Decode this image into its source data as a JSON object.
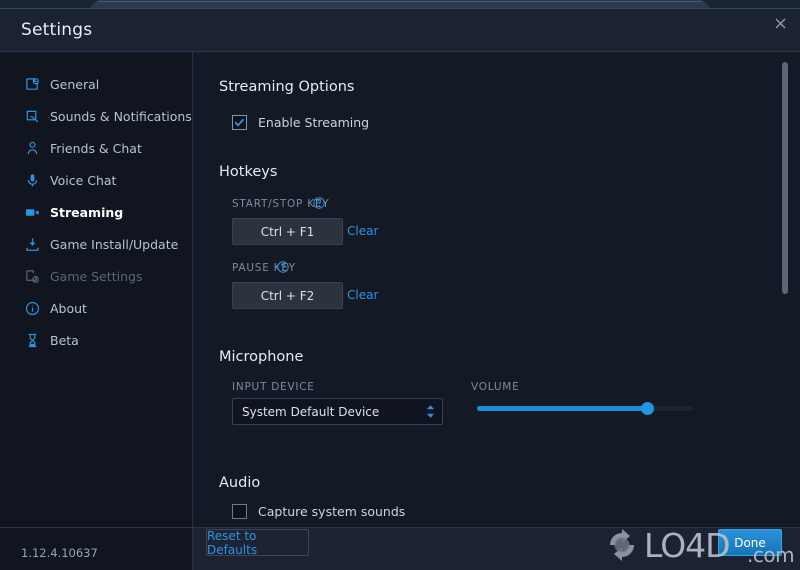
{
  "window": {
    "title": "Settings",
    "close_icon": "close-icon",
    "version": "1.12.4.10637"
  },
  "sidebar": {
    "items": [
      {
        "label": "General",
        "icon": "general-gear-icon",
        "state": "enabled"
      },
      {
        "label": "Sounds & Notifications",
        "icon": "sounds-notifications-icon",
        "state": "enabled"
      },
      {
        "label": "Friends & Chat",
        "icon": "friends-chat-icon",
        "state": "enabled"
      },
      {
        "label": "Voice Chat",
        "icon": "microphone-icon",
        "state": "enabled"
      },
      {
        "label": "Streaming",
        "icon": "video-camera-icon",
        "state": "active"
      },
      {
        "label": "Game Install/Update",
        "icon": "download-icon",
        "state": "enabled"
      },
      {
        "label": "Game Settings",
        "icon": "game-settings-icon",
        "state": "disabled"
      },
      {
        "label": "About",
        "icon": "info-icon",
        "state": "enabled"
      },
      {
        "label": "Beta",
        "icon": "beta-flask-icon",
        "state": "enabled"
      }
    ]
  },
  "main": {
    "streaming_options": {
      "title": "Streaming Options",
      "enable_streaming": {
        "label": "Enable Streaming",
        "checked": true
      }
    },
    "hotkeys": {
      "title": "Hotkeys",
      "start_stop": {
        "label": "START/STOP KEY",
        "help_icon": "help-circle-icon",
        "value": "Ctrl + F1",
        "clear_label": "Clear"
      },
      "pause": {
        "label": "PAUSE KEY",
        "help_icon": "help-circle-icon",
        "value": "Ctrl + F2",
        "clear_label": "Clear"
      }
    },
    "microphone": {
      "title": "Microphone",
      "input_device": {
        "label": "INPUT DEVICE",
        "value": "System Default Device",
        "arrows_icon": "stepper-arrows-icon"
      },
      "volume": {
        "label": "VOLUME",
        "percent": 79
      }
    },
    "audio": {
      "title": "Audio",
      "capture_system_sounds": {
        "label": "Capture system sounds",
        "checked": false
      }
    }
  },
  "footer": {
    "reset_label": "Reset to Defaults",
    "done_label": "Done"
  },
  "watermark": {
    "text": "LO4D",
    "suffix": ".com"
  },
  "colors": {
    "accent": "#2f93e0",
    "panel": "#141a25",
    "sidebar": "#10151f",
    "titlebar": "#1b2231",
    "slider_fill": "#1b8fd6",
    "done_button": "#1b7fc4"
  }
}
